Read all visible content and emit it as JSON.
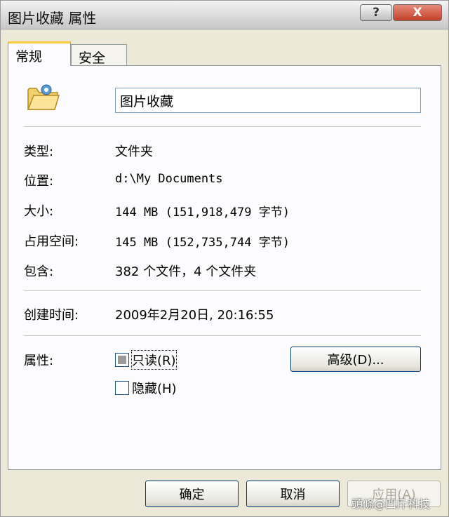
{
  "window": {
    "title": "图片收藏 属性",
    "help_label": "?",
    "close_label": "X"
  },
  "tabs": [
    {
      "label": "常规"
    },
    {
      "label": "安全"
    }
  ],
  "general": {
    "icon": "folder-icon",
    "name_value": "图片收藏",
    "rows": {
      "type": {
        "label": "类型:",
        "value": "文件夹"
      },
      "location": {
        "label": "位置:",
        "value": "d:\\My Documents"
      },
      "size": {
        "label": "大小:",
        "value": "144 MB (151,918,479 字节)"
      },
      "size_on_disk": {
        "label": "占用空间:",
        "value": "145 MB (152,735,744 字节)"
      },
      "contains": {
        "label": "包含:",
        "value": "382 个文件，4 个文件夹"
      },
      "created": {
        "label": "创建时间:",
        "value": "2009年2月20日, 20:16:55"
      }
    },
    "attributes": {
      "label": "属性:",
      "readonly_label": "只读(R)",
      "hidden_label": "隐藏(H)",
      "advanced_label": "高级(D)..."
    }
  },
  "footer": {
    "ok_label": "确定",
    "cancel_label": "取消",
    "apply_label": "应用(A)"
  },
  "watermark": "頭條@凹斤科技",
  "colors": {
    "accent_tab": "#ffc83c",
    "close_button": "#c2412a"
  }
}
